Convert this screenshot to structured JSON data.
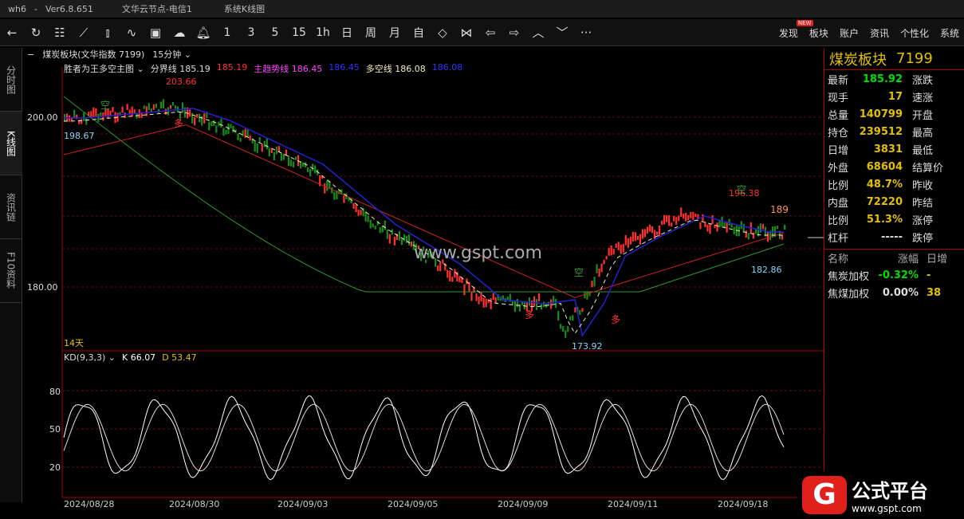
{
  "titlebar": {
    "app": "wh6",
    "sep": "-",
    "version": "Ver6.8.651",
    "server": "文华云节点-电信1",
    "page": "系统K线图"
  },
  "toolbar": {
    "numbers": [
      "1",
      "3",
      "5",
      "15",
      "1h",
      "日",
      "周",
      "月",
      "自"
    ],
    "more": "···",
    "menu": [
      "发现",
      "板块",
      "账户",
      "资讯",
      "个性化",
      "系统"
    ],
    "new_badge": "NEW"
  },
  "sidebar": {
    "tabs": [
      "分时图",
      "K线图",
      "资讯链",
      "F10资料"
    ]
  },
  "header": {
    "instrument": "煤炭板块(文华指数 7199)",
    "period": "15分钟"
  },
  "indicator": {
    "name": "胜者为王多空主图",
    "fenjie_label": "分界线",
    "fenjie_val": "185.19",
    "fenjie_val2": "185.19",
    "trend_label": "主趋势线",
    "trend_val": "186.45",
    "trend_val2": "186.45",
    "duokong_label": "多空线",
    "duokong_val": "186.08",
    "duokong_val2": "186.08"
  },
  "kd": {
    "name": "KD(9,3,3)",
    "k_label": "K 66.07",
    "d_label": "D 53.47"
  },
  "yaxis": {
    "main": [
      "200.00",
      "180.00"
    ],
    "kd": [
      "80",
      "50",
      "20"
    ]
  },
  "xaxis": [
    "2024/08/28",
    "2024/08/30",
    "2024/09/03",
    "2024/09/05",
    "2024/09/09",
    "2024/09/11",
    "2024/09/18"
  ],
  "annotations": {
    "high": "203.66",
    "start": "198.67",
    "low": "173.92",
    "high2": "196.38",
    "low2": "182.86",
    "level": "189",
    "days": "14天",
    "watermark": "www.gspt.com",
    "duo": "多",
    "kong": "空"
  },
  "quote": {
    "name": "煤炭板块",
    "code": "7199",
    "rows": [
      {
        "l": "最新",
        "v": "185.92",
        "r": "涨跌",
        "c": "#00dd00"
      },
      {
        "l": "现手",
        "v": "17",
        "r": "速涨",
        "c": "#e2c000"
      },
      {
        "l": "总量",
        "v": "140799",
        "r": "开盘",
        "c": "#e2c000"
      },
      {
        "l": "持仓",
        "v": "239512",
        "r": "最高",
        "c": "#e2c000"
      },
      {
        "l": "日增",
        "v": "3831",
        "r": "最低",
        "c": "#e2c000"
      },
      {
        "l": "外盘",
        "v": "68604",
        "r": "结算价",
        "c": "#e2c000"
      },
      {
        "l": "比例",
        "v": "48.7%",
        "r": "昨收",
        "c": "#e2c000"
      },
      {
        "l": "内盘",
        "v": "72220",
        "r": "昨结",
        "c": "#e2c000"
      },
      {
        "l": "比例",
        "v": "51.3%",
        "r": "涨停",
        "c": "#e2c000"
      },
      {
        "l": "杠杆",
        "v": "-----",
        "r": "跌停",
        "c": "#ddd"
      }
    ],
    "list_headers": [
      "名称",
      "涨幅",
      "日增"
    ],
    "list": [
      {
        "name": "焦炭加权",
        "chg": "-0.32%",
        "chg_color": "#00dd00",
        "extra": "-"
      },
      {
        "name": "焦煤加权",
        "chg": "0.00%",
        "chg_color": "#ddd",
        "extra": "38"
      }
    ]
  },
  "logo": {
    "mark": "G",
    "main": "公式平台",
    "url": "www.gspt.com"
  },
  "colors": {
    "up": "#ff3030",
    "down": "#1a8c1a",
    "trend": "#2222cc",
    "border": "#aa0000",
    "yellow": "#e2c000"
  }
}
